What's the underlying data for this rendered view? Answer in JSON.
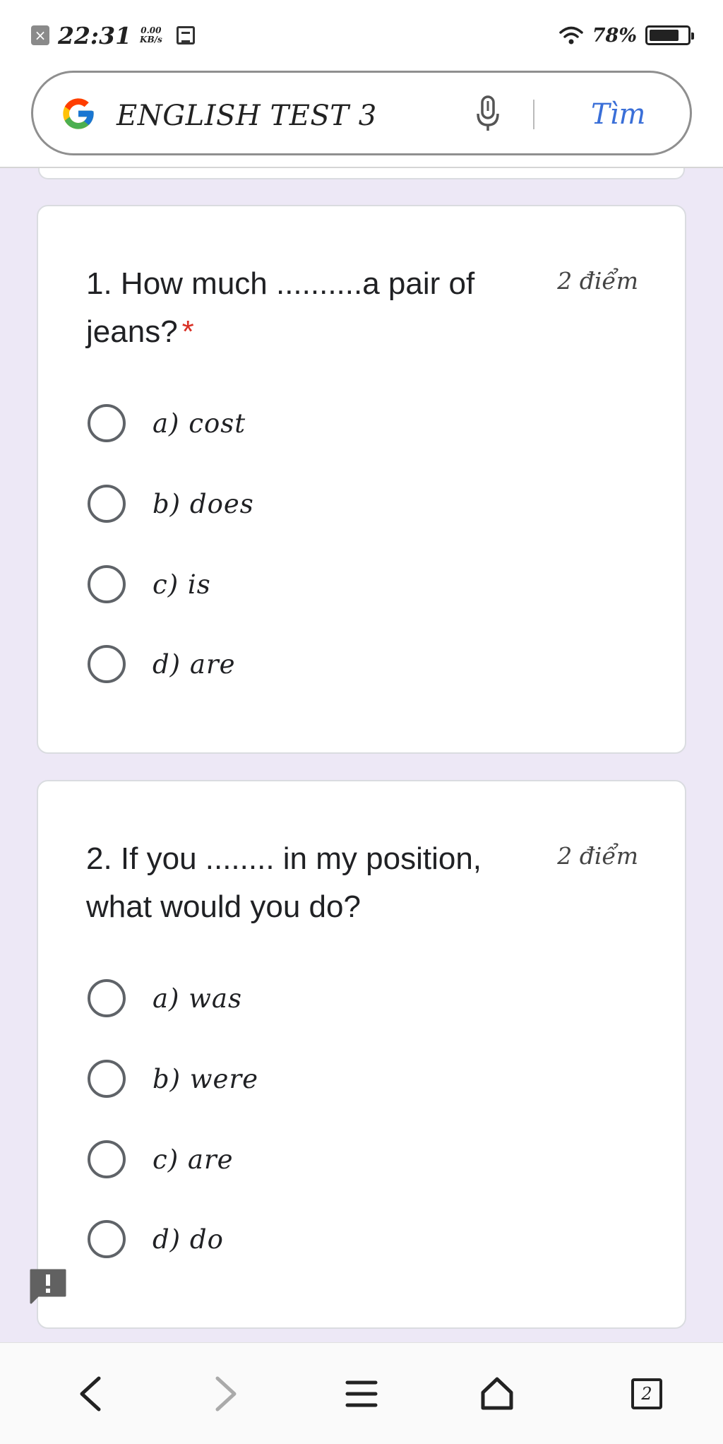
{
  "status_bar": {
    "time": "22:31",
    "net_speed_value": "0.00",
    "net_speed_unit": "KB/s",
    "battery": "78%",
    "battery_level": 0.78,
    "icons": [
      "notification-x-icon",
      "screenshot-icon",
      "wifi-icon",
      "battery-icon"
    ]
  },
  "search_bar": {
    "query": "ENGLISH TEST 3",
    "search_button_label": "Tìm",
    "icons": [
      "google-logo",
      "mic-icon"
    ]
  },
  "questions": [
    {
      "number": "1.",
      "text": "1. How much ..........a pair of jeans?",
      "required_mark": "*",
      "points": "2 điểm",
      "options": [
        "a) cost",
        "b) does",
        "c) is",
        "d) are"
      ]
    },
    {
      "number": "2.",
      "text": "2. If you ........ in my position, what would you do?",
      "required_mark": "",
      "points": "2 điểm",
      "options": [
        "a) was",
        "b) were",
        "c) are",
        "d) do"
      ]
    }
  ],
  "feedback": {
    "icon": "report-issue-icon",
    "glyph": "!"
  },
  "bottom_nav": {
    "tab_count": "2",
    "icons": [
      "back-icon",
      "forward-icon",
      "menu-icon",
      "home-icon",
      "tabs-icon"
    ]
  },
  "colors": {
    "page_background": "#ede8f6",
    "card_background": "#ffffff",
    "required_star": "#d93025",
    "search_button": "#3a6fd8",
    "radio_border": "#5f6368"
  }
}
